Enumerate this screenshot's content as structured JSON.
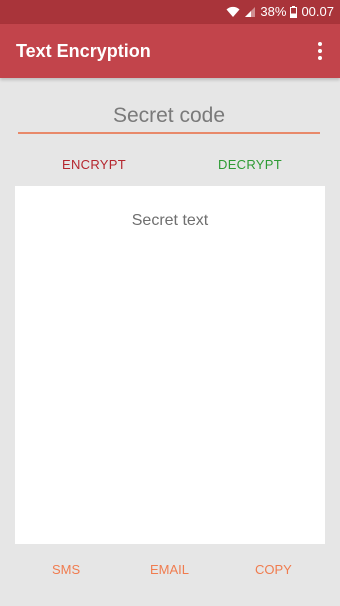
{
  "status_bar": {
    "battery_percent": "38%",
    "time": "00.07",
    "icons": [
      "wifi-icon",
      "signal-icon",
      "battery-icon"
    ]
  },
  "app_bar": {
    "title": "Text Encryption",
    "menu_icon": "more-vert-icon"
  },
  "secret_code": {
    "placeholder": "Secret code",
    "value": ""
  },
  "actions": {
    "encrypt_label": "ENCRYPT",
    "decrypt_label": "DECRYPT"
  },
  "secret_text": {
    "placeholder": "Secret text",
    "value": ""
  },
  "share": {
    "sms_label": "SMS",
    "email_label": "EMAIL",
    "copy_label": "COPY"
  },
  "colors": {
    "status_bar": "#a9343a",
    "app_bar": "#c2444b",
    "encrypt": "#b5262e",
    "decrypt": "#2e9b34",
    "share_actions": "#f07c4f",
    "input_underline": "#e8896a",
    "background": "#e6e6e6"
  }
}
